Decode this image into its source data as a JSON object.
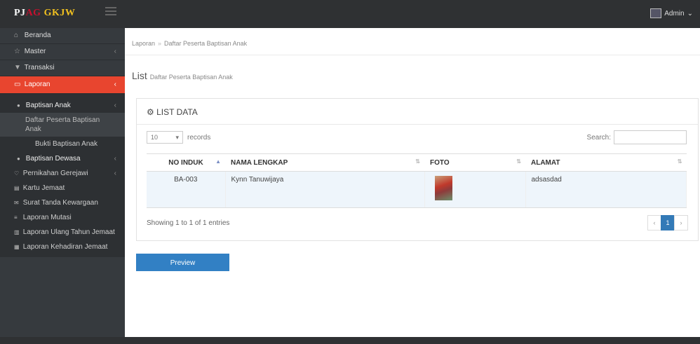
{
  "brand": {
    "part1": "PJ",
    "part2": "AG",
    "part3": " GKJW"
  },
  "user": {
    "name": "Admin"
  },
  "sidebar": {
    "items": [
      {
        "icon": "⌂",
        "label": "Beranda",
        "chevron": ""
      },
      {
        "icon": "☆",
        "label": "Master",
        "chevron": "‹"
      },
      {
        "icon": "▼",
        "label": "Transaksi",
        "chevron": ""
      },
      {
        "icon": "▭",
        "label": "Laporan",
        "chevron": "‹"
      }
    ],
    "submenu": [
      {
        "label": "Baptisan Anak",
        "icon": "●",
        "chevron": "‹"
      },
      {
        "label": "Daftar Peserta Baptisan Anak"
      },
      {
        "label": "Bukti Baptisan Anak"
      },
      {
        "label": "Baptisan Dewasa",
        "icon": "●",
        "chevron": "‹"
      },
      {
        "label": "Pernikahan Gerejawi",
        "icon": "♡",
        "chevron": "‹"
      },
      {
        "label": "Kartu Jemaat",
        "icon": "▤"
      },
      {
        "label": "Surat Tanda Kewargaan",
        "icon": "✉"
      },
      {
        "label": "Laporan Mutasi",
        "icon": "≡"
      },
      {
        "label": "Laporan Ulang Tahun Jemaat",
        "icon": "▥"
      },
      {
        "label": "Laporan Kehadiran Jemaat",
        "icon": "▦"
      }
    ]
  },
  "breadcrumb": {
    "first": "Laporan",
    "separator": "»",
    "second": "Daftar Peserta Baptisan Anak"
  },
  "page": {
    "title": "List",
    "subtitle": "Daftar Peserta Baptisan Anak"
  },
  "card": {
    "title": "LIST DATA"
  },
  "table_controls": {
    "records_value": "10",
    "records_label": "records",
    "search_label": "Search:"
  },
  "table": {
    "headers": [
      "NO INDUK",
      "NAMA LENGKAP",
      "FOTO",
      "ALAMAT"
    ],
    "rows": [
      {
        "no_induk": "BA-003",
        "nama": "Kynn Tanuwijaya",
        "alamat": "adsasdad"
      }
    ]
  },
  "footer": {
    "showing": "Showing 1 to 1 of 1 entries",
    "pager": {
      "prev": "‹",
      "current": "1",
      "next": "›"
    }
  },
  "buttons": {
    "preview": "Preview"
  },
  "colors": {
    "accent": "#e8452f",
    "primary": "#3280c4",
    "topbar": "#2f3133",
    "sidebar": "#363a3e"
  },
  "icons": {
    "toggle": "menu-icon",
    "card": "gear-icon",
    "admin": "user-image-icon"
  }
}
